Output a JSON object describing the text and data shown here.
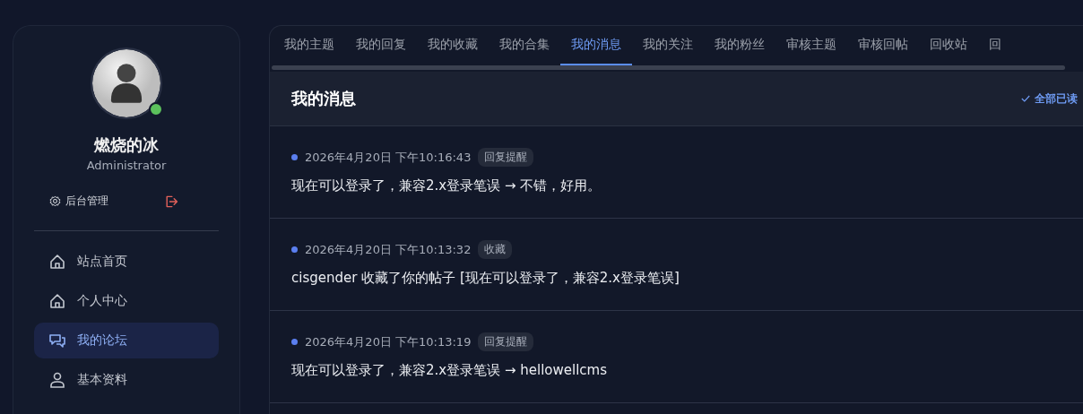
{
  "profile": {
    "name": "燃烧的冰",
    "role": "Administrator",
    "online": true,
    "admin_link": "后台管理"
  },
  "nav": [
    {
      "label": "站点首页",
      "selected": false
    },
    {
      "label": "个人中心",
      "selected": false
    },
    {
      "label": "我的论坛",
      "selected": true
    },
    {
      "label": "基本资料",
      "selected": false
    }
  ],
  "tabs": [
    {
      "label": "我的主题",
      "selected": false
    },
    {
      "label": "我的回复",
      "selected": false
    },
    {
      "label": "我的收藏",
      "selected": false
    },
    {
      "label": "我的合集",
      "selected": false
    },
    {
      "label": "我的消息",
      "selected": true
    },
    {
      "label": "我的关注",
      "selected": false
    },
    {
      "label": "我的粉丝",
      "selected": false
    },
    {
      "label": "审核主题",
      "selected": false
    },
    {
      "label": "审核回帖",
      "selected": false
    },
    {
      "label": "回收站",
      "selected": false
    },
    {
      "label": "回",
      "selected": false
    }
  ],
  "panel": {
    "title": "我的消息",
    "mark_all": "全部已读"
  },
  "messages": [
    {
      "time": "2026年4月20日 下午10:16:43",
      "tag": "回复提醒",
      "unread": true,
      "text": "现在可以登录了，兼容2.x登录笔误 → 不错，好用。"
    },
    {
      "time": "2026年4月20日 下午10:13:32",
      "tag": "收藏",
      "unread": true,
      "text": "cisgender 收藏了你的帖子 [现在可以登录了，兼容2.x登录笔误]"
    },
    {
      "time": "2026年4月20日 下午10:13:19",
      "tag": "回复提醒",
      "unread": true,
      "text": "现在可以登录了，兼容2.x登录笔误 → hellowellcms"
    }
  ]
}
